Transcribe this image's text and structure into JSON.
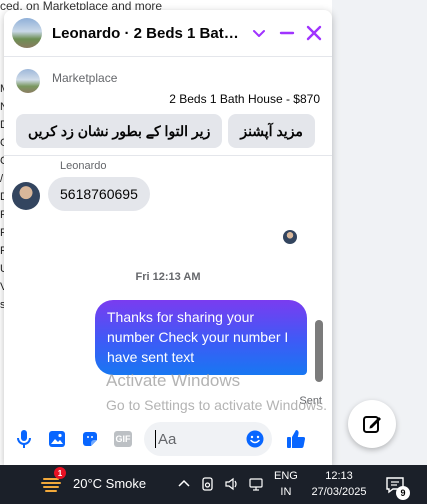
{
  "background_page": {
    "top_text": "ced, on Marketplace and more",
    "left_letters": [
      "M",
      "N",
      "D",
      "",
      "",
      "C",
      "C",
      "/",
      "D",
      "R",
      "F",
      "R",
      "U",
      "V",
      "s"
    ]
  },
  "chat": {
    "title": "Leonardo · 2 Beds 1 Bath H...",
    "marketplace": {
      "label": "Marketplace",
      "listing": "2 Beds 1 Bath House - $870",
      "actions": [
        "مزید آپشنز",
        "زیر التوا کے بطور نشان زد کریں"
      ]
    },
    "messages": {
      "sender_name": "Leonardo",
      "incoming_text": "5618760695",
      "timestamp": "Fri 12:13 AM",
      "outgoing_text": "Thanks for sharing your number Check your number I have sent text",
      "status": "Sent"
    },
    "composer": {
      "placeholder": "Aa"
    }
  },
  "watermark": {
    "line1": "Activate Windows",
    "line2": "Go to Settings to activate Windows."
  },
  "taskbar": {
    "weather_badge": "1",
    "weather_text": "20°C  Smoke",
    "lang_top": "ENG",
    "lang_bottom": "IN",
    "time": "12:13",
    "date": "27/03/2025",
    "notification_count": "9"
  },
  "colors": {
    "accent": "#a033ff",
    "messenger_blue": "#0866ff"
  }
}
